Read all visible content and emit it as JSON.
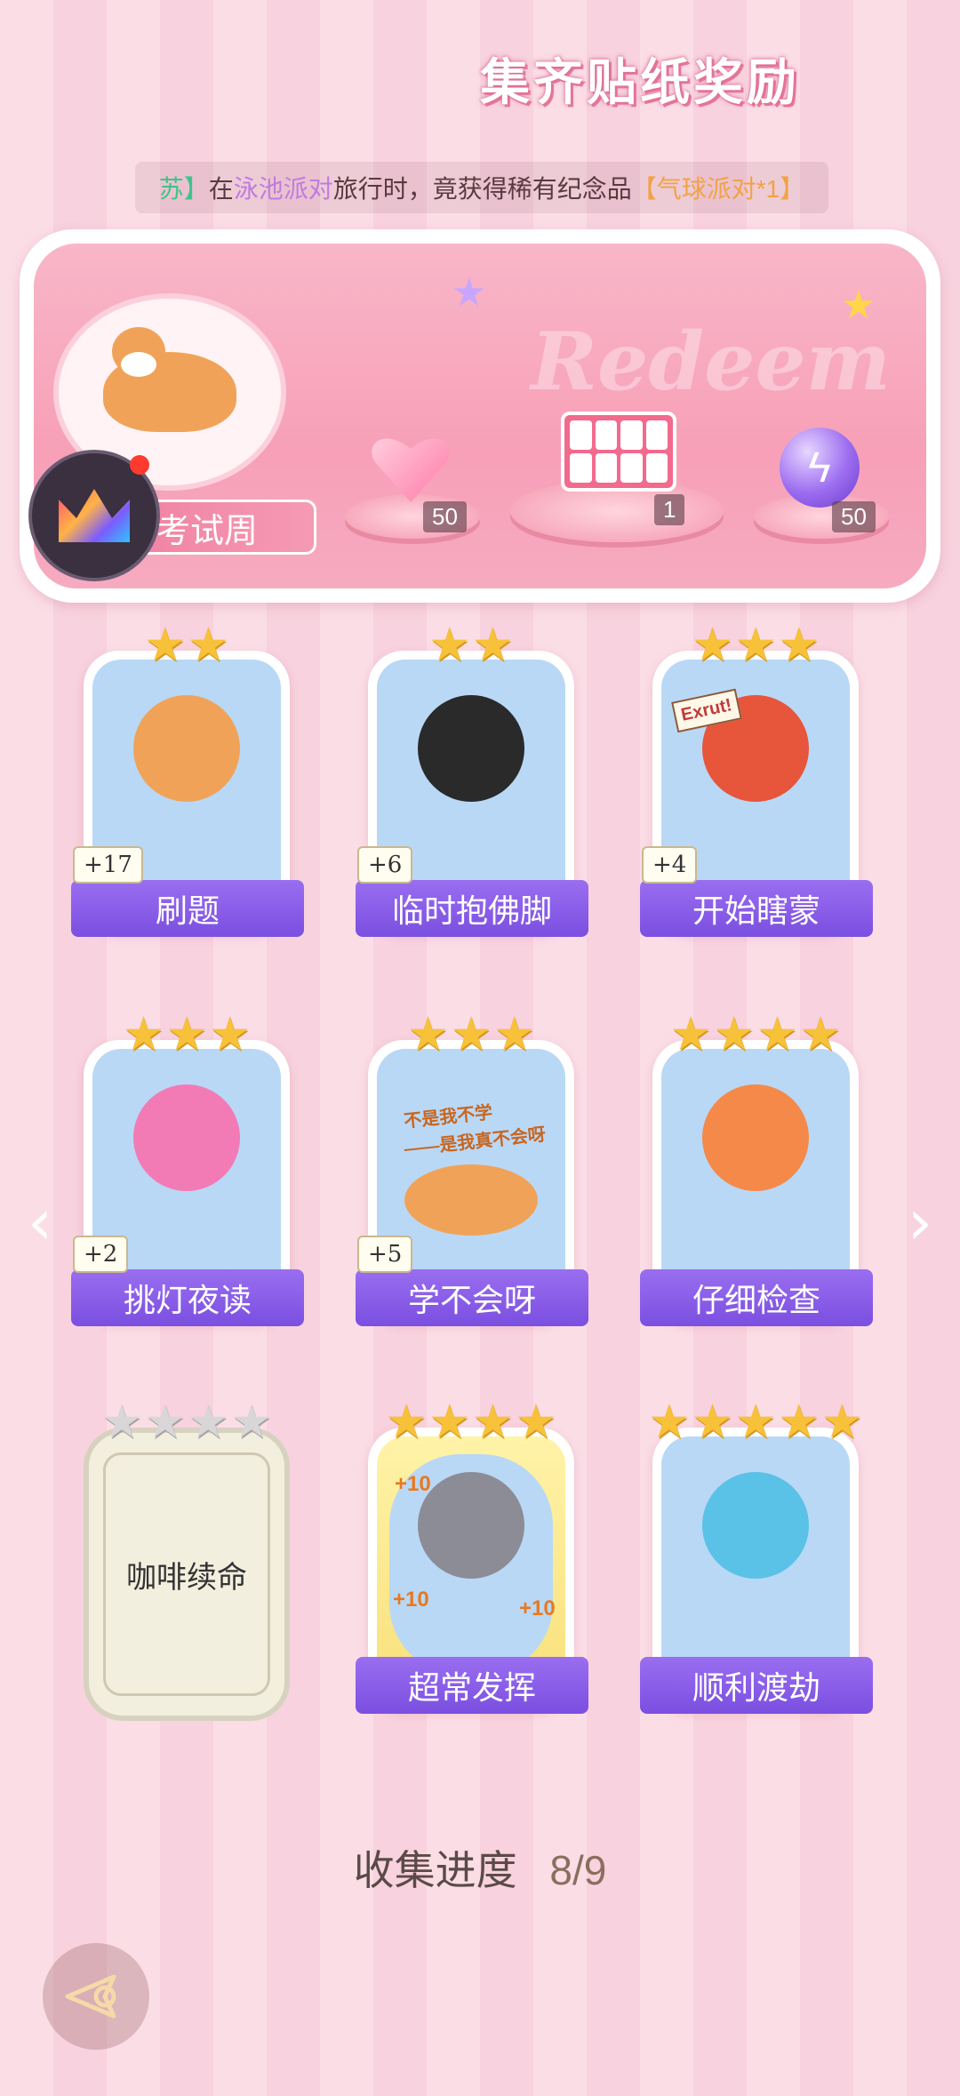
{
  "notice": {
    "name": "苏】",
    "pre": "在",
    "place": "泳池派对",
    "mid": "旅行时，竟获得稀有纪念品",
    "item": "【气球派对*1】"
  },
  "banner": {
    "title": "集齐贴纸奖励",
    "watermark": "Redeem",
    "week_label": "考试周",
    "rewards": [
      {
        "name": "pink-heart-gem",
        "count": "50"
      },
      {
        "name": "sticker-box",
        "count": "1"
      },
      {
        "name": "purple-energy-orb",
        "count": "50"
      }
    ]
  },
  "cards": [
    {
      "label": "刷题",
      "stars": 2,
      "bonus": "+17",
      "locked": false
    },
    {
      "label": "临时抱佛脚",
      "stars": 2,
      "bonus": "+6",
      "locked": false
    },
    {
      "label": "开始瞎蒙",
      "stars": 3,
      "bonus": "+4",
      "locked": false
    },
    {
      "label": "挑灯夜读",
      "stars": 3,
      "bonus": "+2",
      "locked": false
    },
    {
      "label": "学不会呀",
      "stars": 3,
      "bonus": "+5",
      "locked": false
    },
    {
      "label": "仔细检查",
      "stars": 4,
      "bonus": "",
      "locked": false
    },
    {
      "label": "咖啡续命",
      "stars": 4,
      "bonus": "",
      "locked": true
    },
    {
      "label": "超常发挥",
      "stars": 4,
      "bonus": "",
      "locked": false
    },
    {
      "label": "顺利渡劫",
      "stars": 5,
      "bonus": "",
      "locked": false
    }
  ],
  "card_art_text": {
    "exrut_sign": "Exrut!",
    "shiba_caption_1": "不是我不学",
    "shiba_caption_2": "——是我真不会呀",
    "plus_ten": "+10"
  },
  "progress": {
    "label": "收集进度",
    "value": "8/9"
  },
  "colors": {
    "accent_purple": "#8a5ce8",
    "star_gold": "#f7c23a",
    "pink_bg": "#fbdde6"
  }
}
